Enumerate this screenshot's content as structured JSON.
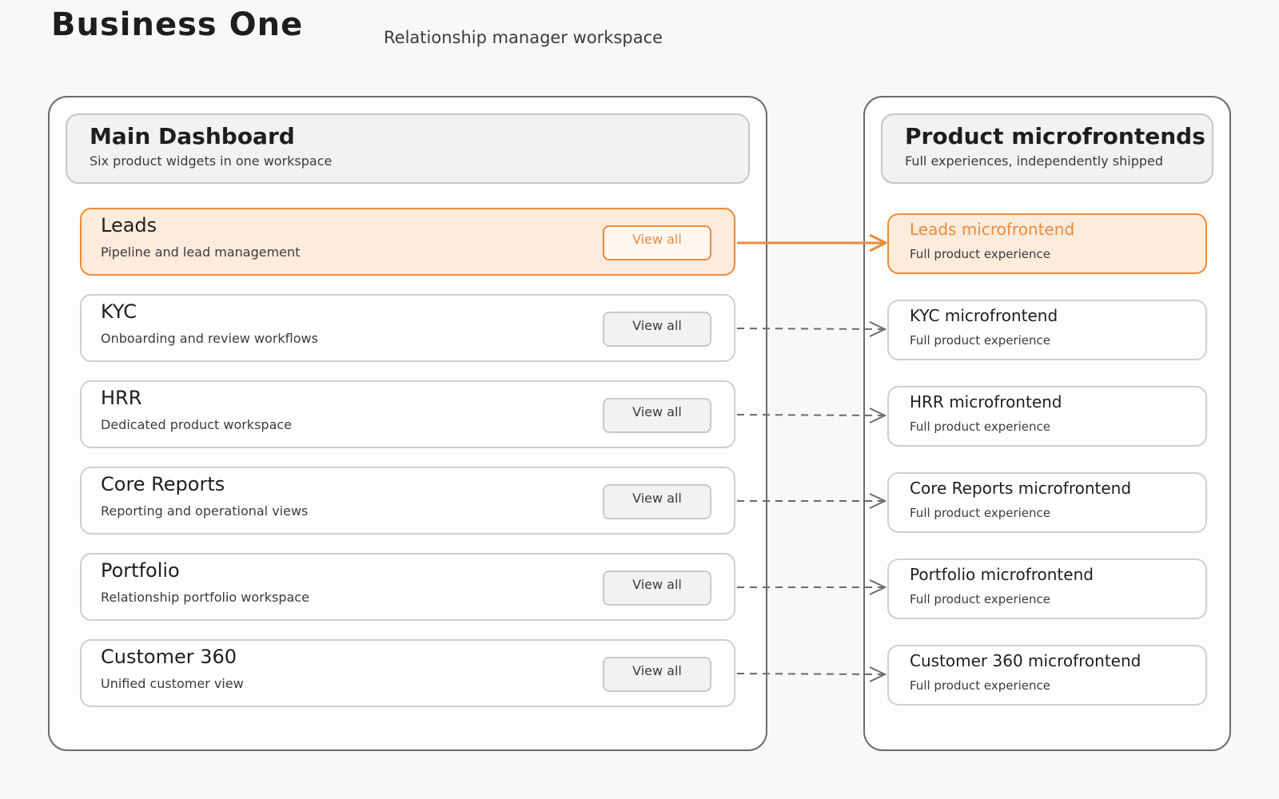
{
  "app": {
    "title": "Business One",
    "subtitle": "Relationship manager workspace"
  },
  "dashboard": {
    "title": "Main Dashboard",
    "description": "Six product widgets in one workspace",
    "widgets": [
      {
        "title": "Leads",
        "description": "Pipeline and lead management",
        "button": "View all",
        "active": true
      },
      {
        "title": "KYC",
        "description": "Onboarding and review workflows",
        "button": "View all",
        "active": false
      },
      {
        "title": "HRR",
        "description": "Dedicated product workspace",
        "button": "View all",
        "active": false
      },
      {
        "title": "Core Reports",
        "description": "Reporting and operational views",
        "button": "View all",
        "active": false
      },
      {
        "title": "Portfolio",
        "description": "Relationship portfolio workspace",
        "button": "View all",
        "active": false
      },
      {
        "title": "Customer 360",
        "description": "Unified customer view",
        "button": "View all",
        "active": false
      }
    ]
  },
  "microfrontends": {
    "title": "Product microfrontends",
    "description": "Full experiences, independently shipped",
    "items": [
      {
        "title": "Leads microfrontend",
        "description": "Full product experience",
        "active": true
      },
      {
        "title": "KYC microfrontend",
        "description": "Full product experience",
        "active": false
      },
      {
        "title": "HRR microfrontend",
        "description": "Full product experience",
        "active": false
      },
      {
        "title": "Core Reports microfrontend",
        "description": "Full product experience",
        "active": false
      },
      {
        "title": "Portfolio microfrontend",
        "description": "Full product experience",
        "active": false
      },
      {
        "title": "Customer 360 microfrontend",
        "description": "Full product experience",
        "active": false
      }
    ]
  },
  "colors": {
    "accent": "#f08a3a",
    "accent_fill": "#fdebdc",
    "connector": "#6b6b6b",
    "border": "#6b6b6b"
  }
}
